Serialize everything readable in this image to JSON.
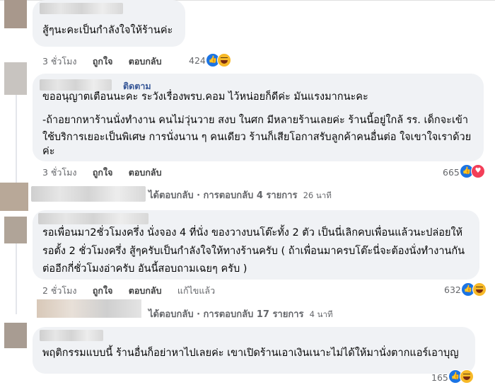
{
  "comments": [
    {
      "text_lines": [
        "สู้ๆนะคะเป็นกำลังใจให้ร้านค่ะ"
      ],
      "time": "3 ชั่วโมง",
      "like_label": "ถูกใจ",
      "reply_label": "ตอบกลับ",
      "reaction_count": "424",
      "reactions": [
        "like-icon",
        "haha-icon"
      ]
    },
    {
      "follow_label": "ติดตาม",
      "text_lines": [
        "ขออนุญาตเตือนนะคะ ระวังเรื่องพรบ.คอม ไว้หน่อยก็ดีค่ะ มันแรงมากนะคะ",
        "",
        "-ถ้าอยากหาร้านนั่งทำงาน คนไม่วุ่นวาย สงบ ในศก มีหลายร้านเลยค่ะ ร้านนี้อยู่ใกล้ รร. เด็กจะเข้า",
        "ใช้บริการเยอะเป็นพิเศษ การนั่งนาน ๆ คนเดียว ร้านก็เสียโอกาสรับลูกค้าคนอื่นต่อ ใจเขาใจเราด้วย",
        "ค่ะ"
      ],
      "time": "3 ชั่วโมง",
      "like_label": "ถูกใจ",
      "reply_label": "ตอบกลับ",
      "reaction_count": "665",
      "reactions": [
        "like-icon",
        "love-icon"
      ]
    },
    {
      "text_lines": [
        "รอเพื่อนมา2ชั่วโมงครึ่ง นั่งจอง 4 ที่นั่ง ของวางบนโต๊ะทั้ง 2 ตัว เป็นนี่เลิกคบเพื่อนแล้วนะปล่อยให้",
        "รอตั้ง 2 ชั่วโมงครึ่ง สู้ๆครับเป็นกำลังใจให้ทางร้านครับ ( ถ้าเพื่อนมาครบโต๊ะนี่จะต้องนั่งทำงานกัน",
        "ต่ออีกกี่ชั่วโมงอ่าครับ อันนี้สอบถามเฉยๆ ครับ )"
      ],
      "time": "2 ชั่วโมง",
      "like_label": "ถูกใจ",
      "reply_label": "ตอบกลับ",
      "edited_label": "แก้ไขแล้ว",
      "reaction_count": "632",
      "reactions": [
        "like-icon",
        "haha-icon"
      ]
    },
    {
      "text_lines": [
        "พฤติกรรมแบบนี้ ร้านอื่นก็อย่าหาไปเลยค่ะ เขาเปิดร้านเอาเงินเนาะไม่ได้ให้มานั่งตากแอร์เอาบุญ"
      ],
      "reaction_count": "165",
      "reactions": [
        "like-icon",
        "haha-icon"
      ]
    }
  ],
  "reply_summaries": [
    {
      "prefix": "ได้ตอบกลับ · การตอบกลับ 4 รายการ",
      "time": "26 นาที"
    },
    {
      "prefix": "ได้ตอบกลับ · การตอบกลับ 17 รายการ",
      "time": "4 นาที"
    }
  ]
}
